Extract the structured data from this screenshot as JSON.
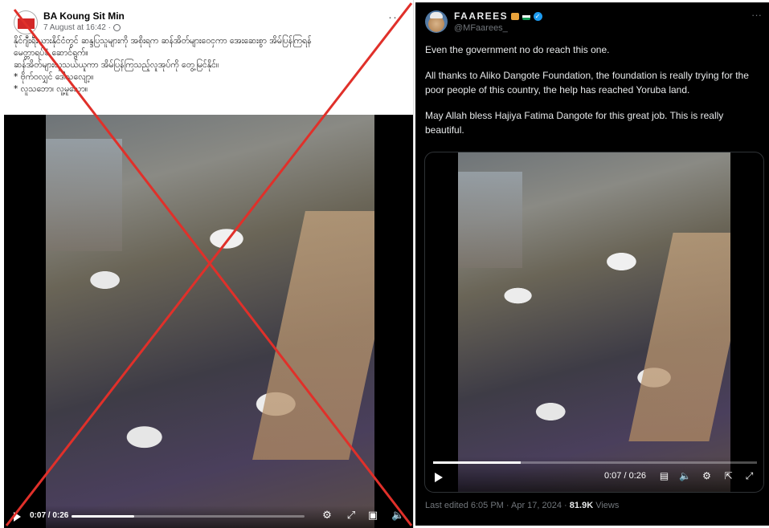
{
  "facebook_post": {
    "author": "BA Koung Sit Min",
    "date": "7 August at 16:42 ·",
    "more": "···",
    "text_lines": [
      "နိုင်ဂျီးရီးယားနိုင်ငံတွင် ဆန္ဒပြသူများကို အစိုးရက ဆန်အိတ်များဝေငှကာ အေးဆေးစွာ အိမ်ပြန်ကြရန်",
      "မေတ္တာရပ်ခံ ဆောင်ရွက်။",
      "ဆန်အိတ်များယူသယ်ယူကာ အိမ်ပြန်ကြသည့်လူအုပ်ကို တွေ့မြင်နိုင်။",
      "* ဗိုက်ဝလျှင် ဒေါသလျော့။",
      "* လူသဘော၊ လူ့မူသော။"
    ],
    "video": {
      "time": "0:07 / 0:26",
      "progress": 0.27,
      "icons": [
        "play-icon",
        "settings-icon",
        "fullscreen-icon",
        "picture-in-picture-icon",
        "volume-icon"
      ]
    },
    "false_marker_color": "#e0302a"
  },
  "tweet": {
    "display_name": "FAAREES",
    "handle": "@MFaarees_",
    "more": "···",
    "paragraphs": [
      "Even the government no do reach this one.",
      "All thanks to Aliko Dangote Foundation, the foundation is really trying for the poor people of this country, the help has reached Yoruba land.",
      "May Allah bless Hajiya Fatima Dangote for this great job. This is really beautiful."
    ],
    "video": {
      "time": "0:07 / 0:26",
      "progress": 0.27,
      "icons": [
        "play-icon",
        "captions-icon",
        "volume-icon",
        "settings-icon",
        "pop-out-icon",
        "fullscreen-icon"
      ]
    },
    "footer": {
      "edited": "Last edited 6:05 PM · Apr 17, 2024 · ",
      "views_count": "81.9K",
      "views_label": " Views"
    },
    "accent_color": "#1d9bf0"
  }
}
